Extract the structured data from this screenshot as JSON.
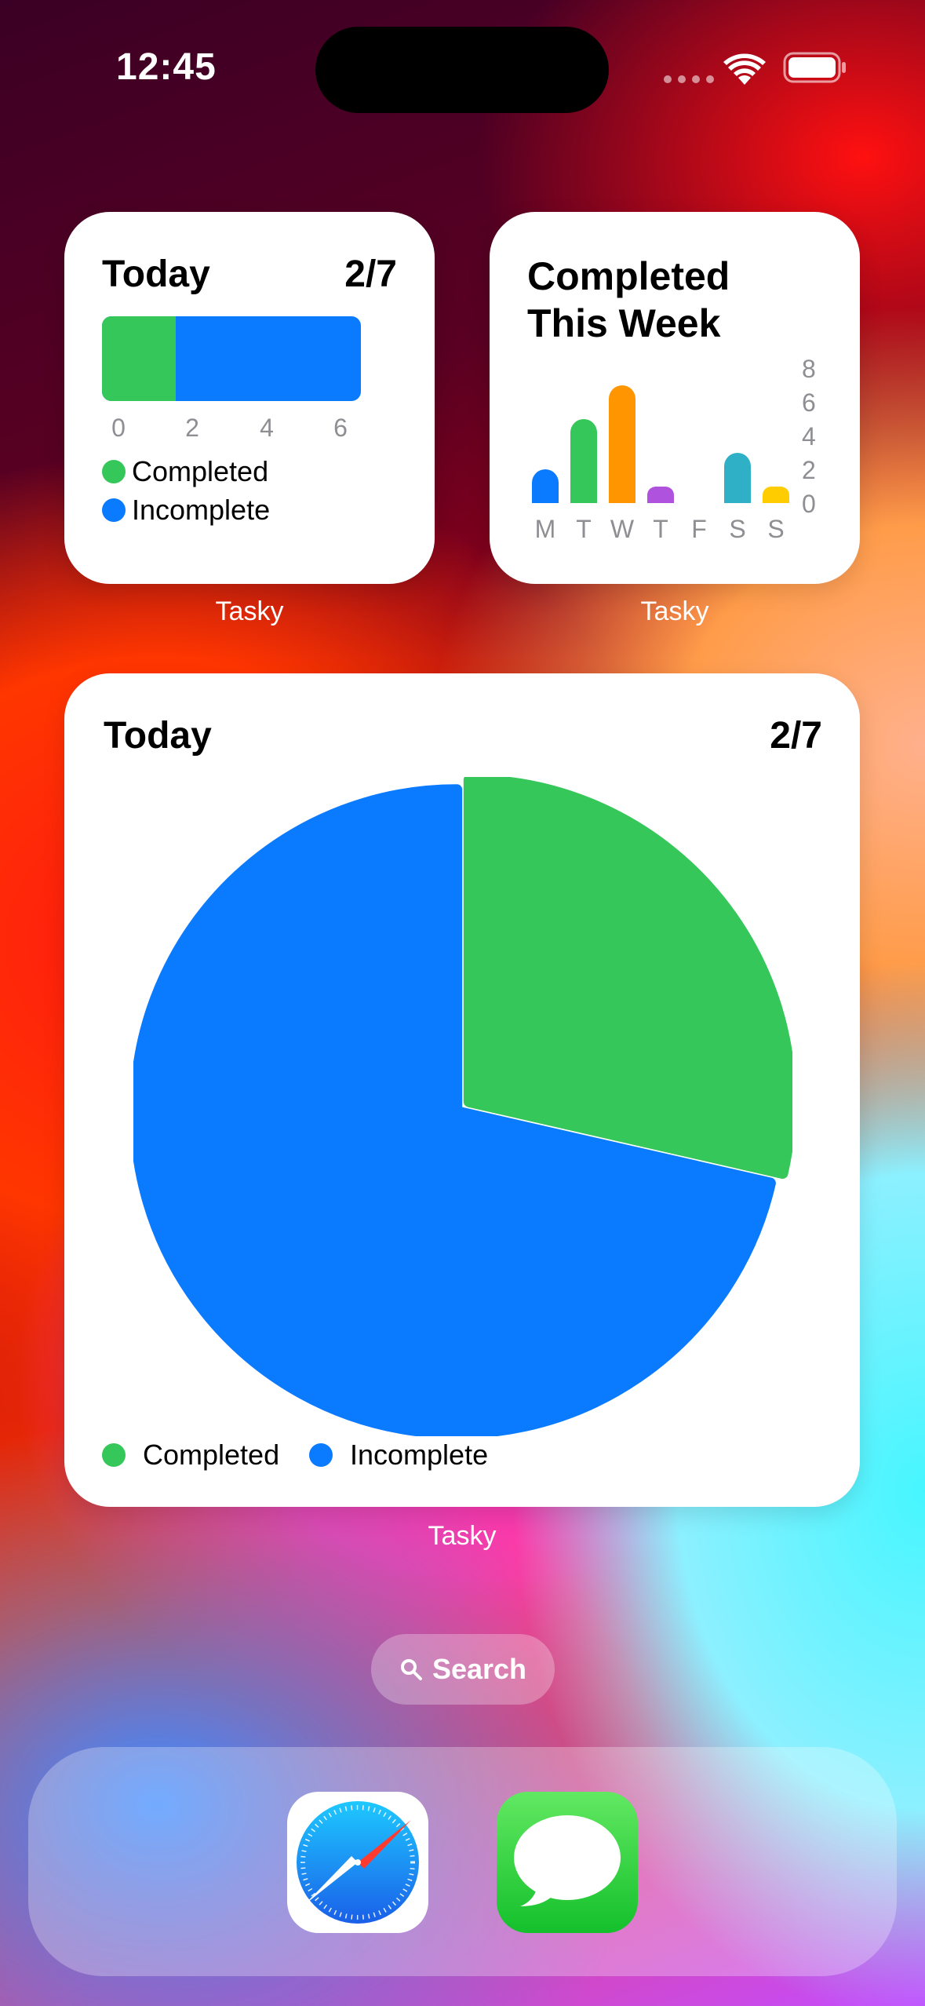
{
  "status_bar": {
    "time": "12:45"
  },
  "widgets": {
    "today_bar": {
      "title": "Today",
      "count": "2/7",
      "completed": 2,
      "total": 7,
      "ticks": [
        "0",
        "2",
        "4",
        "6"
      ],
      "legend": {
        "completed": "Completed",
        "incomplete": "Incomplete"
      },
      "app_label": "Tasky"
    },
    "week_chart": {
      "title_line1": "Completed",
      "title_line2": "This Week",
      "app_label": "Tasky"
    },
    "today_pie": {
      "title": "Today",
      "count": "2/7",
      "legend": {
        "completed": "Completed",
        "incomplete": "Incomplete"
      },
      "app_label": "Tasky"
    }
  },
  "chart_data": [
    {
      "type": "bar",
      "orientation": "horizontal-stacked",
      "title": "Today",
      "series": [
        {
          "name": "Completed",
          "values": [
            2
          ],
          "color": "#35c759"
        },
        {
          "name": "Incomplete",
          "values": [
            5
          ],
          "color": "#0a7aff"
        }
      ],
      "x_ticks": [
        "0",
        "2",
        "4",
        "6"
      ],
      "xlim": [
        0,
        7
      ]
    },
    {
      "type": "bar",
      "title": "Completed This Week",
      "categories": [
        "M",
        "T",
        "W",
        "T",
        "F",
        "S",
        "S"
      ],
      "values": [
        2,
        5,
        7,
        1,
        0,
        3,
        1
      ],
      "colors": [
        "#0a7aff",
        "#35c759",
        "#ff9500",
        "#af52de",
        "#cccccc",
        "#30b0c7",
        "#ffcc00"
      ],
      "y_ticks": [
        "0",
        "2",
        "4",
        "6",
        "8"
      ],
      "ylim": [
        0,
        8
      ]
    },
    {
      "type": "pie",
      "title": "Today",
      "slices": [
        {
          "label": "Completed",
          "value": 2,
          "color": "#35c759"
        },
        {
          "label": "Incomplete",
          "value": 5,
          "color": "#0a7aff"
        }
      ]
    }
  ],
  "search": {
    "label": "Search"
  },
  "dock": {
    "apps": [
      "safari-icon",
      "messages-icon"
    ]
  }
}
